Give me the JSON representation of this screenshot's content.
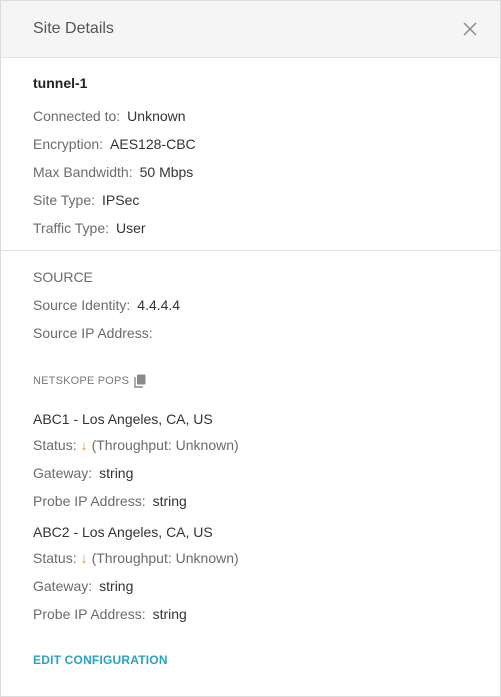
{
  "header": {
    "title": "Site Details"
  },
  "tunnel": {
    "name": "tunnel-1",
    "fields": [
      {
        "label": "Connected to:",
        "value": "Unknown"
      },
      {
        "label": "Encryption:",
        "value": "AES128-CBC"
      },
      {
        "label": "Max Bandwidth:",
        "value": "50 Mbps"
      },
      {
        "label": "Site Type:",
        "value": "IPSec"
      },
      {
        "label": "Traffic Type:",
        "value": "User"
      }
    ]
  },
  "source": {
    "title": "SOURCE",
    "identity_label": "Source Identity:",
    "identity_value": "4.4.4.4",
    "ip_label": "Source IP Address:",
    "ip_value": ""
  },
  "pops": {
    "title": "NETSKOPE POPS",
    "items": [
      {
        "name": "ABC1 - Los Angeles, CA, US",
        "status_label": "Status:",
        "status_arrow": "↓",
        "throughput": "(Throughput: Unknown)",
        "gateway_label": "Gateway:",
        "gateway_value": "string",
        "probe_label": "Probe IP Address:",
        "probe_value": "string"
      },
      {
        "name": "ABC2 - Los Angeles, CA, US",
        "status_label": "Status:",
        "status_arrow": "↓",
        "throughput": "(Throughput: Unknown)",
        "gateway_label": "Gateway:",
        "gateway_value": "string",
        "probe_label": "Probe IP Address:",
        "probe_value": "string"
      }
    ]
  },
  "actions": {
    "edit_label": "EDIT CONFIGURATION"
  },
  "colors": {
    "accent": "#29a1c7",
    "status_down": "#f08a24"
  },
  "icons": {
    "close": "close-icon",
    "copy": "copy-icon",
    "status": "arrow-down-icon"
  }
}
